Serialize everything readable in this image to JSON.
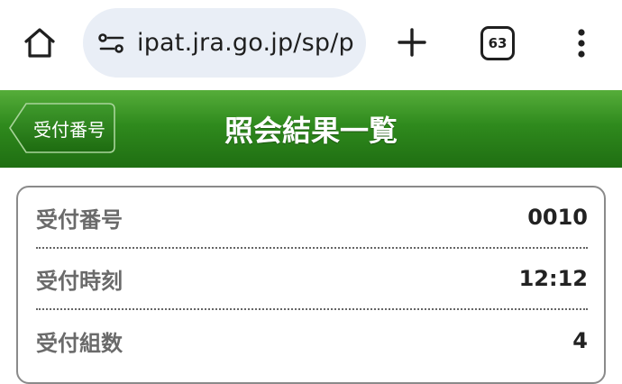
{
  "browser": {
    "url": "ipat.jra.go.jp/sp/p",
    "tab_count": "63",
    "icons": {
      "home": "home-icon",
      "site_info": "tune-icon",
      "new_tab": "plus-icon",
      "tabs": "tab-switcher-icon",
      "menu": "more-vert-icon"
    }
  },
  "header": {
    "back_label": "受付番号",
    "title": "照会結果一覧",
    "colors": {
      "green_top": "#56ad3a",
      "green_bottom": "#1f6e12"
    }
  },
  "info_rows": [
    {
      "label": "受付番号",
      "value": "0010"
    },
    {
      "label": "受付時刻",
      "value": "12:12"
    },
    {
      "label": "受付組数",
      "value": "4"
    }
  ]
}
